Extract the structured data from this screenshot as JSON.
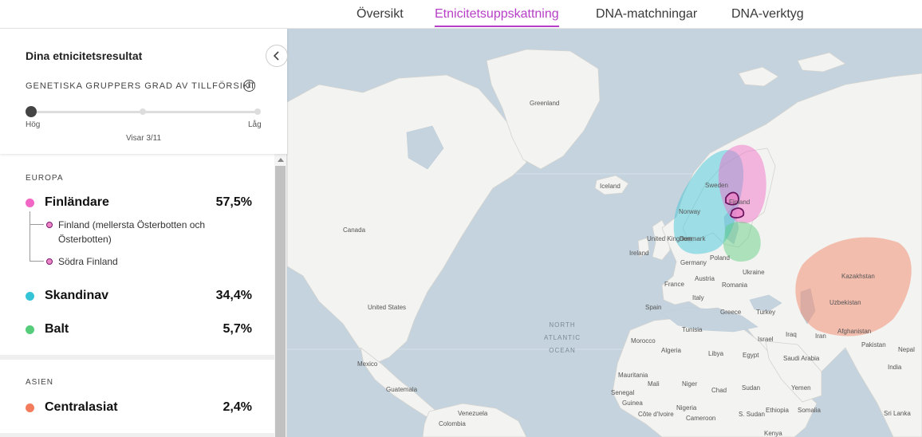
{
  "nav": {
    "tabs": [
      {
        "label": "Översikt",
        "active": false
      },
      {
        "label": "Etnicitetsuppskattning",
        "active": true
      },
      {
        "label": "DNA-matchningar",
        "active": false
      },
      {
        "label": "DNA-verktyg",
        "active": false
      }
    ],
    "accent_color": "#b73fc7"
  },
  "panel": {
    "title": "Dina etnicitetsresultat",
    "confidence_label": "GENETISKA GRUPPERS GRAD AV TILLFÖRSIKT",
    "info_icon": "i",
    "slider": {
      "high_label": "Hög",
      "low_label": "Låg",
      "count_text": "Visar 3/11",
      "value": 0,
      "steps": 3
    },
    "regions": [
      {
        "name": "EUROPA",
        "groups": [
          {
            "name": "Finländare",
            "percent": "57,5%",
            "color": "#f266c6",
            "subgroups": [
              "Finland (mellersta Österbotten och Österbotten)",
              "Södra Finland"
            ]
          },
          {
            "name": "Skandinav",
            "percent": "34,4%",
            "color": "#35c4d7"
          },
          {
            "name": "Balt",
            "percent": "5,7%",
            "color": "#56cd7b"
          }
        ]
      },
      {
        "name": "ASIEN",
        "groups": [
          {
            "name": "Centralasiat",
            "percent": "2,4%",
            "color": "#f47c5c"
          }
        ]
      }
    ]
  },
  "map": {
    "labels": {
      "greenland": "Greenland",
      "iceland": "Iceland",
      "canada": "Canada",
      "united_states": "United States",
      "mexico": "Mexico",
      "guatemala": "Guatemala",
      "venezuela": "Venezuela",
      "colombia": "Colombia",
      "sweden": "Sweden",
      "finland": "Finland",
      "norway": "Norway",
      "denmark": "Denmark",
      "united_kingdom": "United Kingdom",
      "ireland": "Ireland",
      "germany": "Germany",
      "poland": "Poland",
      "ukraine": "Ukraine",
      "france": "France",
      "austria": "Austria",
      "romania": "Romania",
      "italy": "Italy",
      "spain": "Spain",
      "greece": "Greece",
      "turkey": "Turkey",
      "tunisia": "Tunisia",
      "morocco": "Morocco",
      "algeria": "Algeria",
      "libya": "Libya",
      "egypt": "Egypt",
      "iraq": "Iraq",
      "israel": "Israel",
      "iran": "Iran",
      "saudi_arabia": "Saudi Arabia",
      "yemen": "Yemen",
      "mauritania": "Mauritania",
      "mali": "Mali",
      "niger": "Niger",
      "chad": "Chad",
      "sudan": "Sudan",
      "senegal": "Senegal",
      "guinea": "Guinea",
      "cote_divoire": "Côte d'Ivoire",
      "nigeria": "Nigeria",
      "cameroon": "Cameroon",
      "s_sudan": "S. Sudan",
      "ethiopia": "Ethiopia",
      "somalia": "Somalia",
      "kenya": "Kenya",
      "kazakhstan": "Kazakhstan",
      "uzbekistan": "Uzbekistan",
      "afghanistan": "Afghanistan",
      "pakistan": "Pakistan",
      "nepal": "Nepal",
      "india": "India",
      "sri_lanka": "Sri Lanka",
      "ocean": "NORTH ATLANTIC OCEAN"
    }
  }
}
